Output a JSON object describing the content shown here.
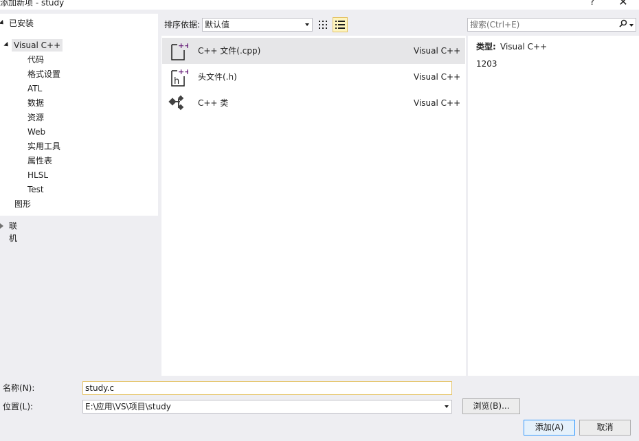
{
  "window": {
    "title": "添加新项 - study",
    "help": "?",
    "close": "✕"
  },
  "tree": {
    "installed": "已安装",
    "visual_cpp": "Visual C++",
    "children": [
      "代码",
      "格式设置",
      "ATL",
      "数据",
      "资源",
      "Web",
      "实用工具",
      "属性表",
      "HLSL",
      "Test"
    ],
    "graphics": "图形",
    "online": "联机"
  },
  "toolbar": {
    "sort_label": "排序依据:",
    "sort_value": "默认值",
    "search_placeholder": "搜索(Ctrl+E)",
    "search_icon": "search-icon"
  },
  "templates": [
    {
      "name": "C++ 文件(.cpp)",
      "lang": "Visual C++",
      "icon": "cpp-file-icon"
    },
    {
      "name": "头文件(.h)",
      "lang": "Visual C++",
      "icon": "header-file-icon"
    },
    {
      "name": "C++ 类",
      "lang": "Visual C++",
      "icon": "cpp-class-icon"
    }
  ],
  "details": {
    "type_label": "类型:",
    "type_value": "Visual C++",
    "description": "1203"
  },
  "form": {
    "name_label": "名称(N):",
    "name_value": "study.c",
    "location_label": "位置(L):",
    "location_value": "E:\\应用\\VS\\项目\\study",
    "browse_button": "浏览(B)...",
    "add_button": "添加(A)",
    "cancel_button": "取消"
  },
  "colors": {
    "accent_purple": "#68217a",
    "selection_bg": "#e6e6e8",
    "dialog_bg": "#eeeef2"
  }
}
